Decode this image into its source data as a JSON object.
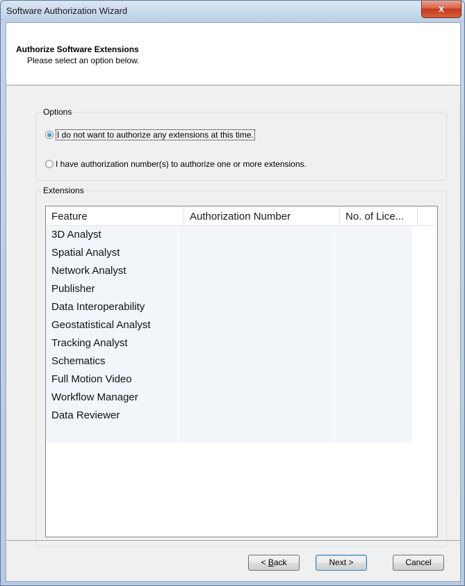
{
  "window": {
    "title": "Software Authorization Wizard",
    "close_glyph": "x"
  },
  "header": {
    "title": "Authorize Software Extensions",
    "subtitle": "Please select an option below."
  },
  "options": {
    "group_label": "Options",
    "items": [
      {
        "label": "I do not want to authorize any extensions at this time.",
        "selected": true
      },
      {
        "label": "I have authorization number(s) to authorize one or more extensions.",
        "selected": false
      }
    ]
  },
  "extensions": {
    "group_label": "Extensions",
    "columns": [
      "Feature",
      "Authorization Number",
      "No. of Lice..."
    ],
    "rows": [
      {
        "feature": "3D Analyst",
        "authorization_number": "",
        "licenses": ""
      },
      {
        "feature": "Spatial Analyst",
        "authorization_number": "",
        "licenses": ""
      },
      {
        "feature": "Network Analyst",
        "authorization_number": "",
        "licenses": ""
      },
      {
        "feature": "Publisher",
        "authorization_number": "",
        "licenses": ""
      },
      {
        "feature": "Data Interoperability",
        "authorization_number": "",
        "licenses": ""
      },
      {
        "feature": "Geostatistical Analyst",
        "authorization_number": "",
        "licenses": ""
      },
      {
        "feature": "Tracking Analyst",
        "authorization_number": "",
        "licenses": ""
      },
      {
        "feature": "Schematics",
        "authorization_number": "",
        "licenses": ""
      },
      {
        "feature": "Full Motion Video",
        "authorization_number": "",
        "licenses": ""
      },
      {
        "feature": "Workflow Manager",
        "authorization_number": "",
        "licenses": ""
      },
      {
        "feature": "Data Reviewer",
        "authorization_number": "",
        "licenses": ""
      },
      {
        "feature": "",
        "authorization_number": "",
        "licenses": ""
      }
    ]
  },
  "buttons": {
    "back_prefix": "< ",
    "back_accel": "B",
    "back_rest": "ack",
    "next": "Next >",
    "cancel": "Cancel"
  },
  "colors": {
    "row_background": "#f2f6fb",
    "selected_radio": "#1a5fb4",
    "close_button": "#c33a1d"
  }
}
